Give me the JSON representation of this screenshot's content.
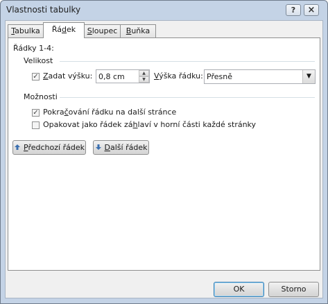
{
  "window": {
    "title": "Vlastnosti tabulky",
    "help_glyph": "?",
    "close_glyph": "×"
  },
  "tabs": [
    {
      "pre": "",
      "u": "T",
      "post": "abulka"
    },
    {
      "pre": "Řá",
      "u": "d",
      "post": "ek"
    },
    {
      "pre": "",
      "u": "S",
      "post": "loupec"
    },
    {
      "pre": "",
      "u": "B",
      "post": "uňka"
    }
  ],
  "active_tab": 1,
  "panel": {
    "rows_caption": "Řádky 1-4:",
    "size_section": "Velikost",
    "specify_height": {
      "checked": true,
      "pre": "",
      "u": "Z",
      "post": "adat výšku:"
    },
    "height_value": "0,8 cm",
    "row_height_is": {
      "pre": "",
      "u": "V",
      "post": "ýška řádku:"
    },
    "row_height_mode": "Přesně",
    "options_section": "Možnosti",
    "allow_break": {
      "checked": true,
      "pre": "Pokra",
      "u": "č",
      "post": "ování řádku na další stránce"
    },
    "repeat_header": {
      "checked": false,
      "pre": "Opakovat jako řádek zá",
      "u": "h",
      "post": "laví v horní části každé stránky"
    },
    "prev_row": {
      "pre": "",
      "u": "P",
      "post": "ředchozí řádek"
    },
    "next_row": {
      "pre": "",
      "u": "D",
      "post": "alší řádek"
    }
  },
  "footer": {
    "ok": "OK",
    "cancel": "Storno"
  },
  "colors": {
    "accent_arrow": "#3a6fb0"
  }
}
